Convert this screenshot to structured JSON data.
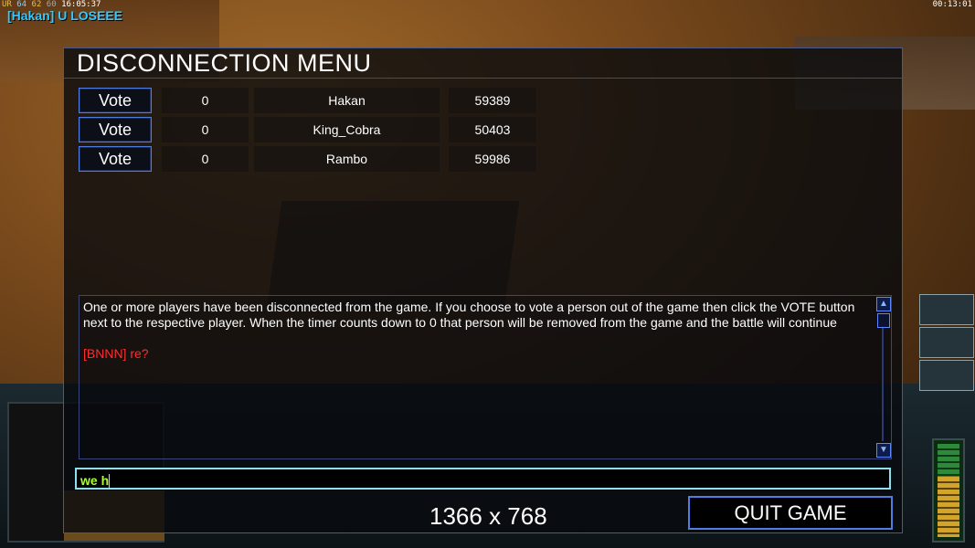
{
  "hud": {
    "top_left_stats": {
      "label": "UR",
      "v1": "64",
      "v2": "62",
      "v3": "60",
      "clock": "16:05:37"
    },
    "player_tag": "[Hakan] U LOSEEE",
    "game_timer": "00:13:01"
  },
  "panel": {
    "title": "DISCONNECTION MENU",
    "players": [
      {
        "vote_label": "Vote",
        "votes": "0",
        "name": "Hakan",
        "ping": "59389"
      },
      {
        "vote_label": "Vote",
        "votes": "0",
        "name": "King_Cobra",
        "ping": "50403"
      },
      {
        "vote_label": "Vote",
        "votes": "0",
        "name": "Rambo",
        "ping": "59986"
      }
    ],
    "info_message": "One or more players have been disconnected from the game. If you choose to vote a person out of the game then click the VOTE button next to the respective player. When the timer counts down to 0 that person will be removed from the game and the battle will continue",
    "chat_line": "[BNNN] re?",
    "chat_input_value": "we h",
    "resolution": "1366 x 768",
    "quit_label": "QUIT GAME"
  },
  "colors": {
    "accent_blue": "#4f7de0",
    "chat_red": "#ff2e2e",
    "input_green": "#a8ff3a",
    "player_tag": "#34c9ff"
  }
}
